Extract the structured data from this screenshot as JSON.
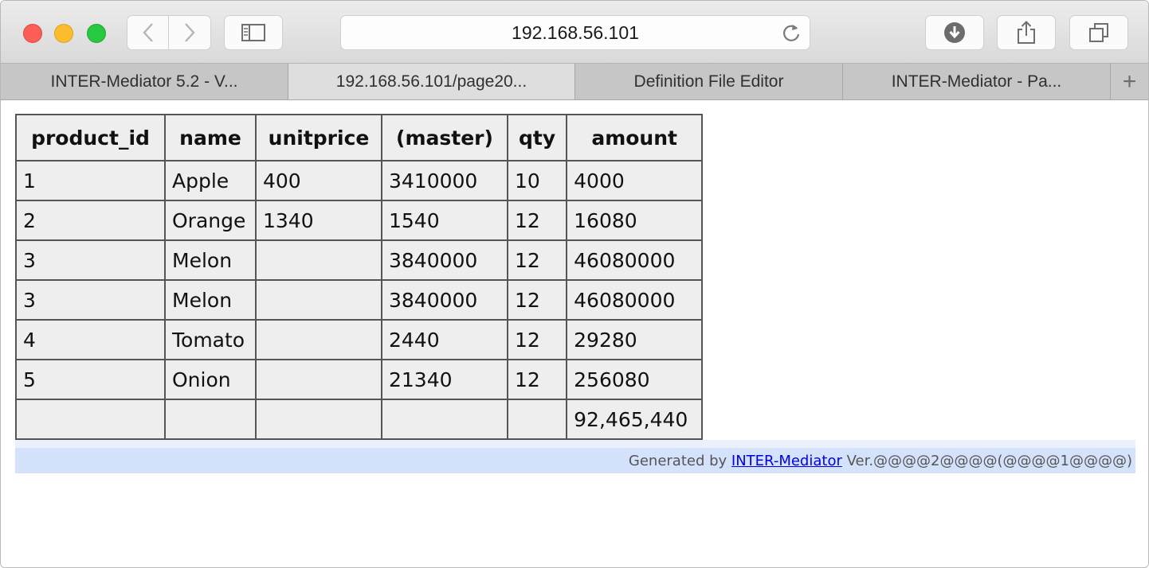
{
  "browser": {
    "url": "192.168.56.101",
    "tabs": [
      {
        "label": "INTER-Mediator 5.2 - V...",
        "active": false
      },
      {
        "label": "192.168.56.101/page20...",
        "active": true
      },
      {
        "label": "Definition File Editor",
        "active": false
      },
      {
        "label": "INTER-Mediator - Pa...",
        "active": false
      }
    ],
    "new_tab_label": "+"
  },
  "table": {
    "headers": [
      "product_id",
      "name",
      "unitprice",
      "(master)",
      "qty",
      "amount"
    ],
    "rows": [
      [
        "1",
        "Apple",
        "400",
        "3410000",
        "10",
        "4000"
      ],
      [
        "2",
        "Orange",
        "1340",
        "1540",
        "12",
        "16080"
      ],
      [
        "3",
        "Melon",
        "",
        "3840000",
        "12",
        "46080000"
      ],
      [
        "3",
        "Melon",
        "",
        "3840000",
        "12",
        "46080000"
      ],
      [
        "4",
        "Tomato",
        "",
        "2440",
        "12",
        "29280"
      ],
      [
        "5",
        "Onion",
        "",
        "21340",
        "12",
        "256080"
      ],
      [
        "",
        "",
        "",
        "",
        "",
        "92,465,440"
      ]
    ]
  },
  "footer": {
    "prefix": "Generated by ",
    "link": "INTER-Mediator",
    "suffix": " Ver.@@@@2@@@@(@@@@1@@@@)"
  }
}
